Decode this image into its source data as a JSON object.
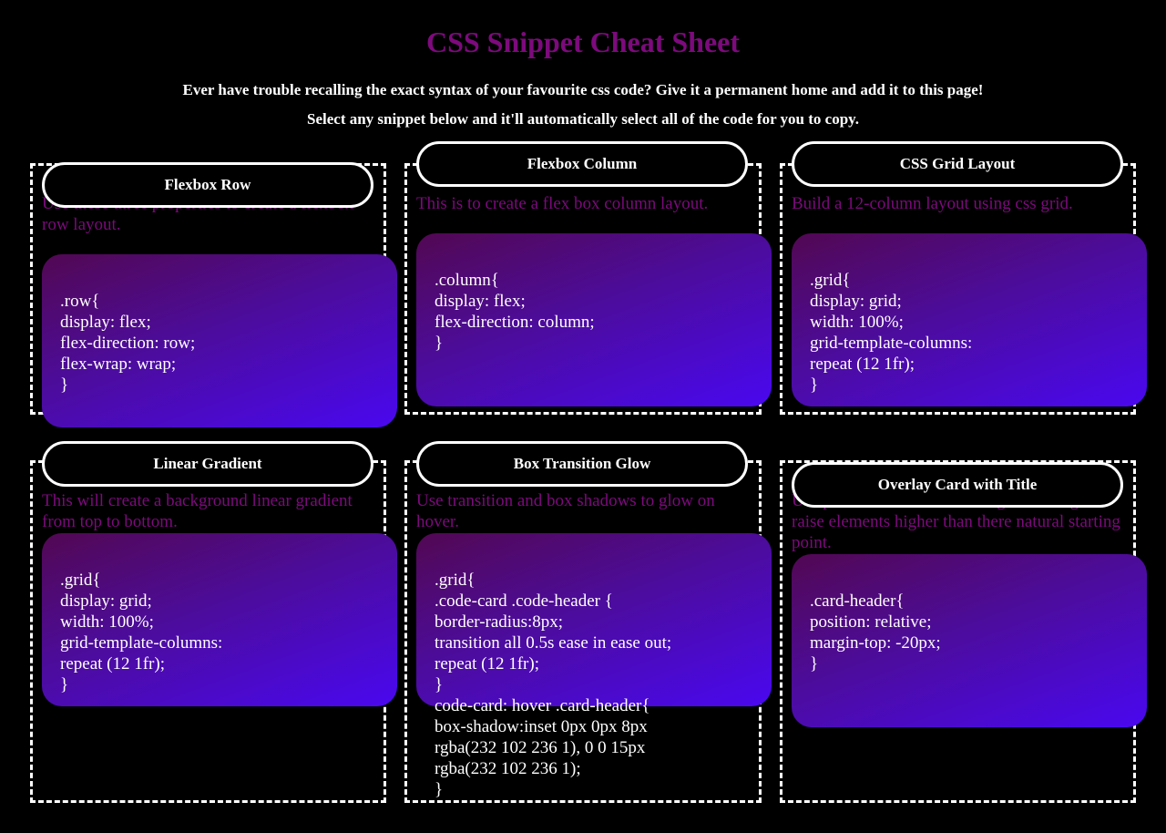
{
  "header": {
    "title": "CSS Snippet Cheat Sheet",
    "intro_line1": "Ever have trouble recalling the exact syntax of your favourite css code? Give it a permanent home and add it to this page!",
    "intro_line2": "Select any snippet below and it'll automatically select all of the code for you to copy."
  },
  "cards": [
    {
      "title": "Flexbox Row",
      "description": "Use these three properties to create a flexbox row layout.",
      "code": ".row{\ndisplay: flex;\nflex-direction: row;\nflex-wrap: wrap;\n}"
    },
    {
      "title": "Flexbox Column",
      "description": "This is to create a flex box column layout.",
      "code": ".column{\ndisplay: flex;\nflex-direction: column;\n}"
    },
    {
      "title": "CSS Grid Layout",
      "description": "Build a 12-column layout using css grid.",
      "code": ".grid{\ndisplay: grid;\nwidth: 100%;\ngrid-template-columns:\nrepeat (12 1fr);\n}"
    },
    {
      "title": "Linear Gradient",
      "description": "This will create a background linear gradient from top to bottom.",
      "code": ".grid{\ndisplay: grid;\nwidth: 100%;\ngrid-template-columns:\nrepeat (12 1fr);\n}"
    },
    {
      "title": "Box Transition Glow",
      "description": "Use transition and box shadows to glow on hover.",
      "code": ".grid{\n.code-card .code-header {\nborder-radius:8px;\ntransition all 0.5s ease in ease out;\nrepeat (12 1fr);\n}\ncode-card: hover .card-header{\nbox-shadow:inset 0px 0px 8px\nrgba(232 102 236 1), 0 0 15px\nrgba(232 102 236 1);\n}"
    },
    {
      "title": "Overlay Card with Title",
      "description": "Use position relative and a negative margin to raise elements higher than there natural starting point.",
      "code": ".card-header{\nposition: relative;\nmargin-top: -20px;\n}"
    }
  ],
  "colors": {
    "title": "#7d0a7d",
    "description": "#7d0a7d",
    "background": "#000000",
    "gradient_start": "#520852",
    "gradient_end": "#4a08f0"
  }
}
